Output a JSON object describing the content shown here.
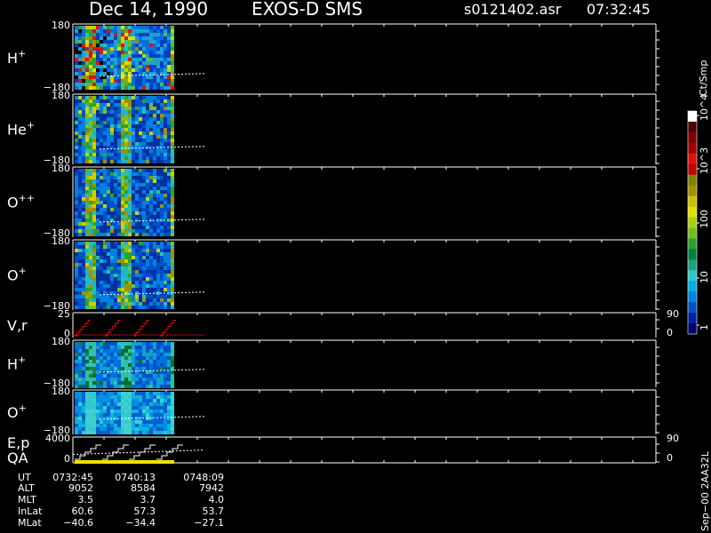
{
  "header": {
    "date": "Dec 14, 1990",
    "mission": "EXOS-D SMS",
    "file": "s0121402.asr",
    "time": "07:32:45"
  },
  "colorbar": {
    "unit_label": "Ct/Smp",
    "tick_labels": [
      "1",
      "10",
      "100",
      "10^3",
      "10^4"
    ],
    "colors": [
      "#000070",
      "#0020a0",
      "#0050c8",
      "#0080e0",
      "#00b0e0",
      "#30c8c8",
      "#20a080",
      "#008040",
      "#30a030",
      "#70c020",
      "#a8d010",
      "#e0e000",
      "#c8c000",
      "#a09000",
      "#808000",
      "#c00000",
      "#e01010",
      "#a00000",
      "#800000",
      "#500000",
      "#ffffff"
    ]
  },
  "panels": [
    {
      "id": "H+",
      "label_base": "H",
      "label_sup": "+",
      "y_top": "180",
      "y_bottom": "−180",
      "type": "spectrogram",
      "tone": "hot"
    },
    {
      "id": "He+",
      "label_base": "He",
      "label_sup": "+",
      "y_top": "180",
      "y_bottom": "−180",
      "type": "spectrogram",
      "tone": "warm"
    },
    {
      "id": "O++",
      "label_base": "O",
      "label_sup": "++",
      "y_top": "180",
      "y_bottom": "−180",
      "type": "spectrogram",
      "tone": "warm"
    },
    {
      "id": "O+",
      "label_base": "O",
      "label_sup": "+",
      "y_top": "180",
      "y_bottom": "−180",
      "type": "spectrogram",
      "tone": "warm"
    },
    {
      "id": "V,r",
      "label_base": "V,r",
      "label_sup": "",
      "y_top": "25",
      "y_bottom": "0",
      "right_top": "90",
      "right_bottom": "0",
      "type": "line"
    },
    {
      "id": "H+2",
      "label_base": "H",
      "label_sup": "+",
      "y_top": "180",
      "y_bottom": "−180",
      "type": "spectrogram",
      "tone": "cool"
    },
    {
      "id": "O+2",
      "label_base": "O",
      "label_sup": "+",
      "y_top": "180",
      "y_bottom": "−180",
      "type": "spectrogram",
      "tone": "cyan"
    },
    {
      "id": "E,p QA",
      "label_base": "E,p",
      "label_line2": "QA",
      "label_sup": "",
      "y_top": "4000",
      "y_bottom": "0",
      "right_top": "90",
      "right_bottom": "0",
      "type": "line2"
    }
  ],
  "chart_data": {
    "type": "heatmap",
    "title": "Dec 14, 1990   EXOS-D SMS",
    "x_range": [
      "07:32:45",
      "07:48:09"
    ],
    "x_tick_labels": [
      "0732:45",
      "0740:13",
      "0748:09"
    ],
    "panels": [
      "H+",
      "He+",
      "O++",
      "O+",
      "V,r",
      "H+",
      "O+",
      "E,p QA"
    ],
    "log_color_scale": true,
    "color_range": [
      1,
      10000
    ]
  },
  "ephemeris": {
    "labels": [
      "UT",
      "ALT",
      "MLT",
      "InLat",
      "MLat"
    ],
    "columns": [
      [
        "0732:45",
        "9052",
        "3.5",
        "60.6",
        "−40.6"
      ],
      [
        "0740:13",
        "8584",
        "3.7",
        "57.3",
        "−34.4"
      ],
      [
        "0748:09",
        "7942",
        "4.0",
        "53.7",
        "−27.1"
      ]
    ]
  },
  "footer": {
    "build_stamp": "Sep−00 2AA32L"
  }
}
